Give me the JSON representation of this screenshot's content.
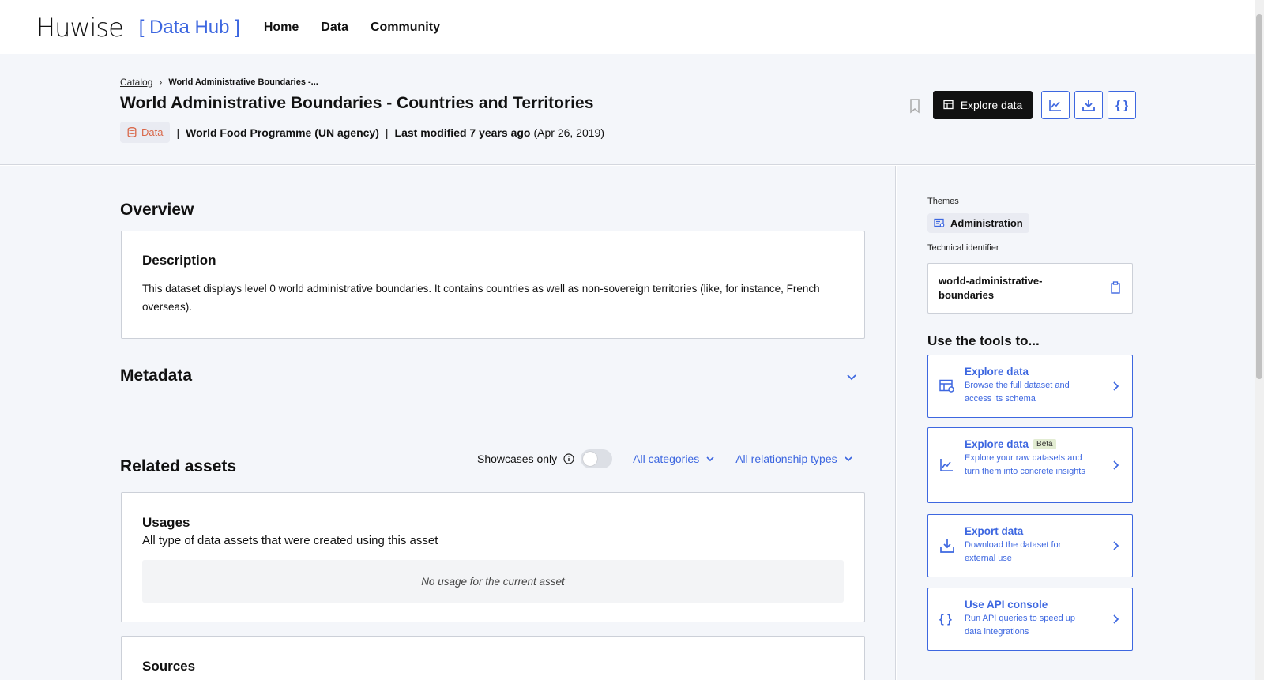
{
  "nav": {
    "logo": "Huwise",
    "hub": "[ Data Hub ]",
    "links": [
      "Home",
      "Data",
      "Community"
    ]
  },
  "breadcrumb": {
    "root": "Catalog",
    "current": "World Administrative Boundaries -..."
  },
  "header": {
    "title": "World Administrative Boundaries - Countries and Territories",
    "type_badge": "Data",
    "publisher": "World Food Programme (UN agency)",
    "modified_label": "Last modified 7 years ago",
    "modified_date": "(Apr 26, 2019)",
    "explore_button": "Explore data"
  },
  "overview": {
    "heading": "Overview",
    "description_title": "Description",
    "description_text": "This dataset displays level 0 world administrative boundaries. It contains countries as well as non-sovereign territories (like, for instance, French overseas)."
  },
  "metadata": {
    "heading": "Metadata"
  },
  "related": {
    "heading": "Related assets",
    "showcases_label": "Showcases only",
    "showcases_on": false,
    "categories_filter": "All categories",
    "relationship_filter": "All relationship types",
    "usages": {
      "title": "Usages",
      "subtitle": "All type of data assets that were created using this asset",
      "empty": "No usage for the current asset"
    },
    "sources": {
      "title": "Sources"
    }
  },
  "sidebar": {
    "themes_label": "Themes",
    "theme": "Administration",
    "tech_id_label": "Technical identifier",
    "tech_id": "world-administrative-boundaries",
    "tools_heading": "Use the tools to...",
    "tools": [
      {
        "title": "Explore data",
        "desc": "Browse the full dataset and access its schema",
        "icon": "table-search-icon"
      },
      {
        "title": "Explore data",
        "badge": "Beta",
        "desc": "Explore your raw datasets and turn them into concrete insights",
        "icon": "chart-search-icon"
      },
      {
        "title": "Export data",
        "desc": "Download the dataset for external use",
        "icon": "download-icon"
      },
      {
        "title": "Use API console",
        "desc": "Run API queries to speed up data integrations",
        "icon": "braces-icon"
      }
    ]
  },
  "colors": {
    "accent": "#3d67e0",
    "background": "#f4f6fa",
    "data_badge": "#d9684a"
  }
}
